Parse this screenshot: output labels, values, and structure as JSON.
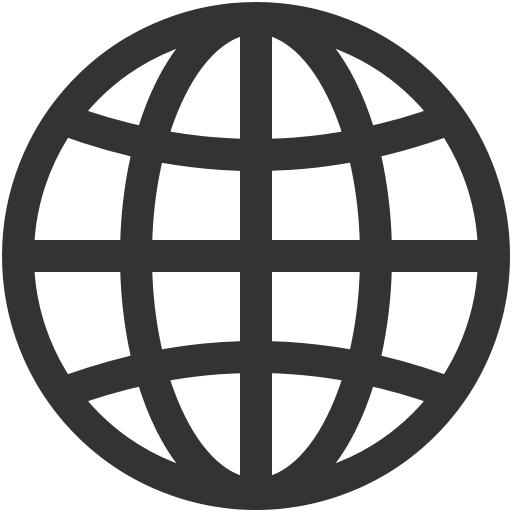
{
  "icon": {
    "name": "globe-icon",
    "color": "#333333",
    "background": "#ffffff"
  }
}
